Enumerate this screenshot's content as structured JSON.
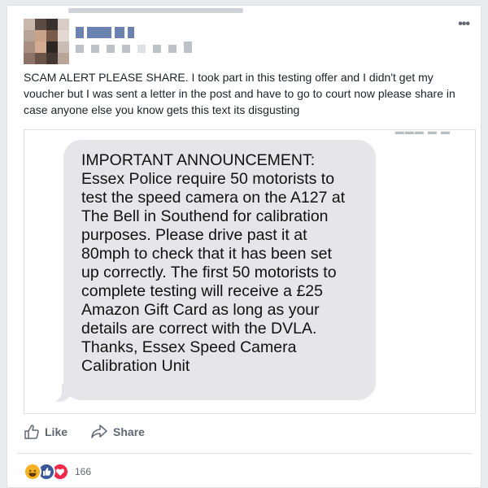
{
  "post": {
    "body": "SCAM ALERT PLEASE SHARE. I took part in this testing offer and I didn't get my voucher but I was sent a letter in the post and have to go to court now please share in case anyone else you know gets this text its disgusting"
  },
  "message": {
    "lines": [
      "IMPORTANT ANNOUNCEMENT:",
      "Essex Police require 50 motorists to",
      "test the speed camera on the A127 at",
      "The Bell in Southend for calibration",
      "purposes. Please drive past it at",
      "80mph to check that it has been set",
      "up correctly. The first 50 motorists to",
      "complete testing will receive a £25",
      "Amazon Gift Card as long as your",
      "details are correct with the DVLA.",
      "Thanks, Essex Speed Camera",
      "Calibration Unit"
    ]
  },
  "actions": {
    "like_label": "Like",
    "share_label": "Share"
  },
  "reactions": {
    "count": "166",
    "types": [
      "haha",
      "like",
      "love"
    ]
  },
  "colors": {
    "background": "#e9ebee",
    "bubble": "#e5e5ea",
    "like_blue": "#3b5998",
    "love_red": "#f0284a",
    "haha_yellow": "#f7b125"
  },
  "icons": {
    "more": "more-options-icon",
    "like": "thumbs-up-icon",
    "share": "share-arrow-icon"
  }
}
